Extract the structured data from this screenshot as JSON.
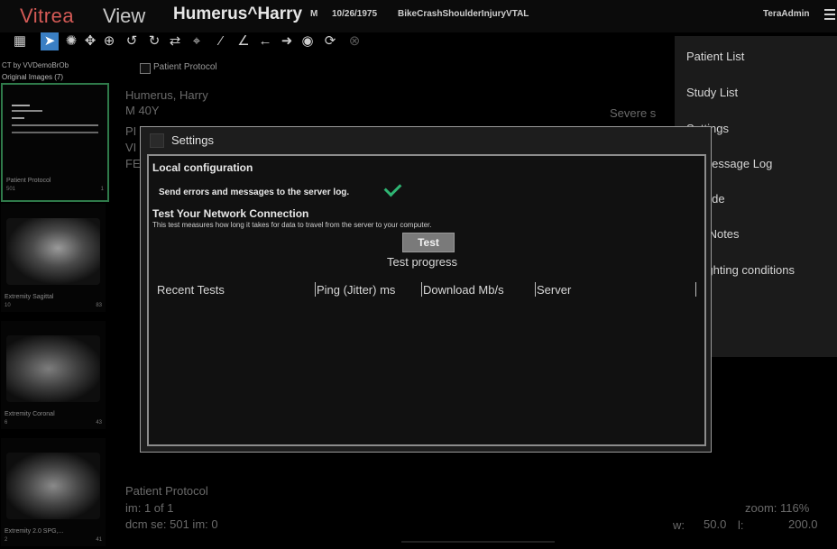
{
  "header": {
    "logo_brand": "Vitrea",
    "logo_product": "View",
    "patient_name": "Humerus^Harry",
    "sex": "M",
    "dob": "10/26/1975",
    "study": "BikeCrashShoulderInjuryVTAL",
    "user": "TeraAdmin"
  },
  "toolbar": {
    "icons": [
      "layout-icon",
      "pointer-icon",
      "window-level-icon",
      "pan-icon",
      "zoom-icon",
      "rotate-left-icon",
      "rotate-right-icon",
      "flip-icon",
      "crosshair-icon",
      "line-measure-icon",
      "angle-measure-icon",
      "arrow-left-icon",
      "arrow-right-icon",
      "eye-icon",
      "refresh-icon",
      "close-icon"
    ]
  },
  "study_bar": {
    "study_info": "CT by VVDemoBrOb",
    "original_images": "Original Images (7)",
    "patient_protocol_label": "Patient Protocol"
  },
  "thumbnails": [
    {
      "label": "Patient Protocol",
      "sub": "501",
      "count": "1"
    },
    {
      "label": "Extremity Sagittal",
      "sub": "10",
      "count": "83"
    },
    {
      "label": "Extremity Coronal",
      "sub": "6",
      "count": "43"
    },
    {
      "label": "Extremity 2.0 SPG,...",
      "sub": "2",
      "count": "41"
    }
  ],
  "viewer": {
    "name": "Humerus, Harry",
    "age": "M 40Y",
    "line3": "PI",
    "line4": "VI",
    "line5": "FE",
    "right_label": "Severe s",
    "protocol": "Patient Protocol",
    "image_index": "im: 1 of 1",
    "dcm": "dcm se: 501 im: 0",
    "zoom": "zoom: 116%",
    "wl_w_label": "w:",
    "wl_w": "50.0",
    "wl_l_label": "l:",
    "wl_l": "200.0"
  },
  "menu": {
    "items": [
      "Patient List",
      "Study List",
      "Settings",
      "us Message Log",
      "r Guide",
      "ase Notes",
      "ck lighting conditions",
      "ut",
      "out"
    ]
  },
  "settings": {
    "title": "Settings",
    "local_config": "Local configuration",
    "send_errors": "Send errors and messages to the server log.",
    "net_title": "Test Your Network Connection",
    "net_desc": "This test measures how long it takes for data to travel from the server to your computer.",
    "test_button": "Test",
    "test_progress": "Test progress",
    "columns": [
      "Recent Tests",
      "Ping (Jitter) ms",
      "Download Mb/s",
      "Server"
    ]
  }
}
